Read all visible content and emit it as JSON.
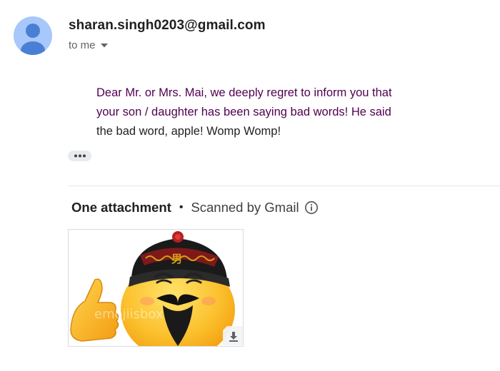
{
  "header": {
    "sender": "sharan.singh0203@gmail.com",
    "recipient": "to me",
    "avatar_icon": "person-icon",
    "expand_icon": "caret-down-icon"
  },
  "message": {
    "line1": "Dear Mr. or Mrs. Mai, we deeply regret to inform you that",
    "line2": "your son / daughter has been saying bad words! He said",
    "line3": "the bad word, apple! Womp Womp!",
    "trimmed_icon": "more-horizontal-icon"
  },
  "attachments": {
    "count_label": "One attachment",
    "separator": "•",
    "scan_label": "Scanned by Gmail",
    "info_icon": "info-icon",
    "thumbnail": {
      "chinese_character": "男",
      "watermark": "emojiisbox",
      "download_icon": "download-icon"
    }
  },
  "colors": {
    "avatar_bg": "#a8c7fa",
    "avatar_fg": "#4a7fd6",
    "quoted_text": "#500050",
    "body_text": "#222222"
  }
}
